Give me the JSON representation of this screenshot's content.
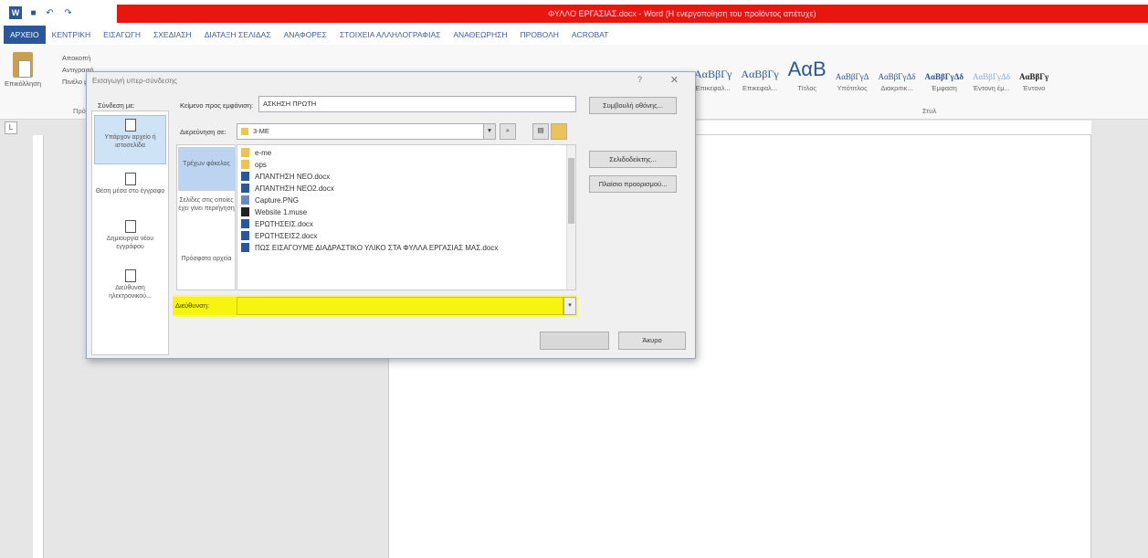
{
  "window": {
    "title": "ΦΥΛΛΟ ΕΡΓΑΣΙΑΣ.docx - Word (Η ενεργοποίηση του προϊόντος απέτυχε)",
    "app_logo_letter": "W",
    "quick_access": {
      "undo": "↶",
      "redo": "↷"
    }
  },
  "ribbon_tabs": [
    "ΑΡΧΕΙΟ",
    "ΚΕΝΤΡΙΚΗ",
    "ΕΙΣΑΓΩΓΗ",
    "ΣΧΕΔΙΑΣΗ",
    "ΔΙΑΤΑΞΗ ΣΕΛΙΔΑΣ",
    "ΑΝΑΦΟΡΕΣ",
    "ΣΤΟΙΧΕΙΑ ΑΛΛΗΛΟΓΡΑΦΙΑΣ",
    "ΑΝΑΘΕΩΡΗΣΗ",
    "ΠΡΟΒΟΛΗ",
    "ACROBAT"
  ],
  "ribbon": {
    "paste_label": "Επικόλληση",
    "clipboard_items": [
      "Αποκοπή",
      "Αντιγραφή",
      "Πινέλο μορφοποίησης"
    ],
    "clipboard_group": "Πρόχειρο",
    "styles": [
      {
        "sample": "ΑαΒβΓγ",
        "name": "Επικεφαλ..."
      },
      {
        "sample": "ΑαΒβΓγ",
        "name": "Επικεφαλ..."
      },
      {
        "sample": "ΑαΒ",
        "name": "Τίτλος"
      },
      {
        "sample": "ΑαΒβΓγΔ",
        "name": "Υπότιτλος"
      },
      {
        "sample": "ΑαΒβΓγΔδ",
        "name": "Διακριτικ..."
      },
      {
        "sample": "ΑαΒβΓγΔδ",
        "name": "Έμφαση"
      },
      {
        "sample": "ΑαΒβΓγΔδ",
        "name": "Έντονη έμ..."
      },
      {
        "sample": "ΑαΒβΓγ",
        "name": "Έντονο"
      }
    ],
    "styles_group": "Στυλ"
  },
  "ruler": {
    "corner": "L"
  },
  "dialog": {
    "title": "Εισαγωγή υπερ-σύνδεσης",
    "help": "?",
    "close": "✕",
    "link_to_label": "Σύνδεση με:",
    "display_text_label": "Κείμενο προς εμφάνιση:",
    "display_text_value": "ΑΣΚΗΣΗ ΠΡΩΤΗ",
    "tooltip_button": "Συμβουλή οθόνης...",
    "look_in_label": "Διερεύνηση σε:",
    "look_in_value": "3-ΜΕ",
    "bookmark_button": "Σελιδοδείκτης...",
    "target_frame_button": "Πλαίσιο προορισμού...",
    "link_options": [
      "Υπάρχον αρχείο ή ιστοσελίδα",
      "Θέση μέσα στο έγγραφο",
      "Δημιουργία νέου εγγράφου",
      "Διεύθυνση ηλεκτρονικού..."
    ],
    "places": [
      "Τρέχων φάκελος",
      "Σελίδες στις οποίες έχει γίνει περιήγηση",
      "Πρόσφατα αρχεία"
    ],
    "files": [
      {
        "name": "e-me",
        "type": "folder"
      },
      {
        "name": "ops",
        "type": "folder"
      },
      {
        "name": "ΑΠΑΝΤΗΣΗ ΝΕΟ.docx",
        "type": "doc"
      },
      {
        "name": "ΑΠΑΝΤΗΣΗ ΝΕΟ2.docx",
        "type": "doc"
      },
      {
        "name": "Capture.PNG",
        "type": "img"
      },
      {
        "name": "Website 1.muse",
        "type": "muse"
      },
      {
        "name": "ΕΡΩΤΗΣΕΙΣ.docx",
        "type": "doc"
      },
      {
        "name": "ΕΡΩΤΗΣΕΙΣ2.docx",
        "type": "doc"
      },
      {
        "name": "ΠΩΣ ΕΙΣΑΓΟΥΜΕ ΔΙΑΔΡΑΣΤΙΚΟ ΥΛΙΚΟ ΣΤΑ ΦΥΛΛΑ ΕΡΓΑΣΙΑΣ ΜΑΣ.docx",
        "type": "doc"
      }
    ],
    "address_label": "Διεύθυνση:",
    "address_value": "",
    "ok_button": "",
    "cancel_button": "Άκυρο"
  },
  "colors": {
    "titlebar_red": "#e8160f",
    "file_tab_blue": "#2b579a",
    "highlight_yellow": "#f7f50f"
  }
}
